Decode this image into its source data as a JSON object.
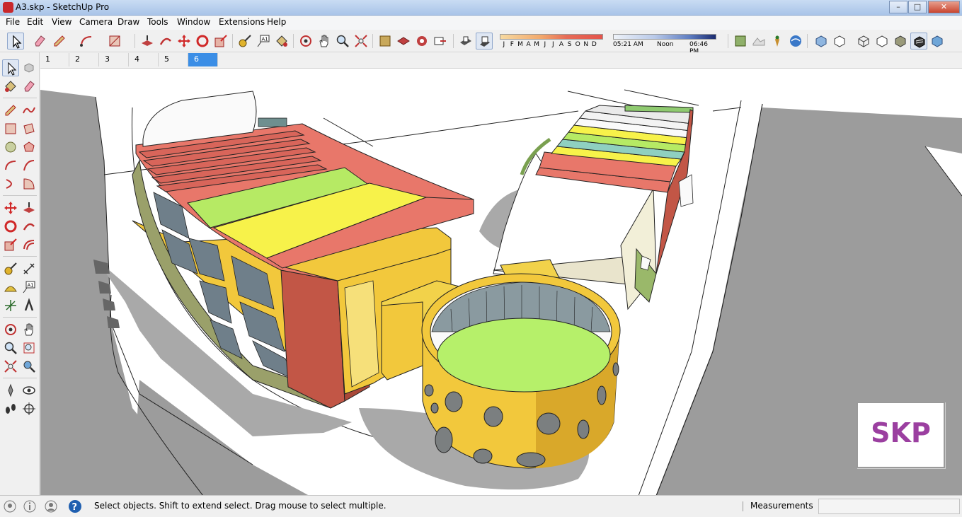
{
  "window": {
    "title": "A3.skp - SketchUp Pro"
  },
  "menu": [
    "File",
    "Edit",
    "View",
    "Camera",
    "Draw",
    "Tools",
    "Window",
    "Extensions",
    "Help"
  ],
  "shadow_settings": {
    "months": [
      "J",
      "F",
      "M",
      "A",
      "M",
      "J",
      "J",
      "A",
      "S",
      "O",
      "N",
      "D"
    ],
    "time_start": "05:21 AM",
    "time_mid": "Noon",
    "time_end": "06:46 PM"
  },
  "scene_tabs": [
    "1",
    "2",
    "3",
    "4",
    "5",
    "6"
  ],
  "active_scene_index": 5,
  "logo": {
    "text": "SKP",
    "color": "#9b3fa0"
  },
  "status": {
    "hint": "Select objects. Shift to extend select. Drag mouse to select multiple.",
    "measurements_label": "Measurements",
    "measurements_value": ""
  },
  "colors": {
    "accent": "#3b8ee6",
    "roof_red": "#e8776a",
    "roof_yellow": "#f7f24a",
    "roof_green": "#b6f06a",
    "wall_yellow": "#f4c83a",
    "wall_red": "#c45a4a"
  }
}
